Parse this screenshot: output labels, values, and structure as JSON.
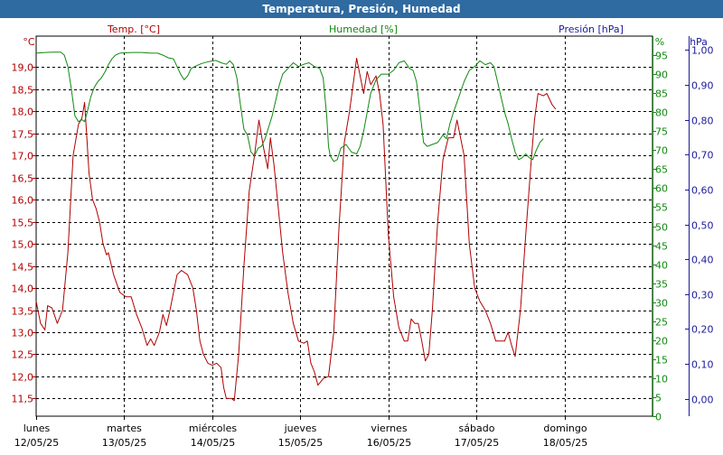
{
  "window": {
    "title": "Temperatura, Presión, Humedad"
  },
  "headers": {
    "temp": "Temp. [°C]",
    "hum": "Humedad [%]",
    "press": "Presión [hPa]"
  },
  "units": {
    "temp": "°C",
    "hum": "%",
    "press": "hPa"
  },
  "colors": {
    "temp": "#b00000",
    "hum": "#118811",
    "press": "#1a1a9a",
    "title_bg": "#2f6aa0"
  },
  "chart_data": {
    "type": "line",
    "title": "Temperatura, Presión, Humedad",
    "grid": true,
    "x_unit": "days",
    "x_range": [
      0,
      7
    ],
    "x_tick_days": [
      0,
      1,
      2,
      3,
      4,
      5,
      6
    ],
    "x_ticks": [
      {
        "day": "lunes",
        "date": "12/05/25"
      },
      {
        "day": "martes",
        "date": "13/05/25"
      },
      {
        "day": "miércoles",
        "date": "14/05/25"
      },
      {
        "day": "jueves",
        "date": "15/05/25"
      },
      {
        "day": "viernes",
        "date": "16/05/25"
      },
      {
        "day": "sábado",
        "date": "17/05/25"
      },
      {
        "day": "domingo",
        "date": "18/05/25"
      }
    ],
    "axes": {
      "temp": {
        "ylim": [
          11.1,
          19.7
        ],
        "ticks": [
          "11,5",
          "12,0",
          "12,5",
          "13,0",
          "13,5",
          "14,0",
          "14,5",
          "15,0",
          "15,5",
          "16,0",
          "16,5",
          "17,0",
          "17,5",
          "18,0",
          "18,5",
          "19,0"
        ],
        "tick_values": [
          11.5,
          12.0,
          12.5,
          13.0,
          13.5,
          14.0,
          14.5,
          15.0,
          15.5,
          16.0,
          16.5,
          17.0,
          17.5,
          18.0,
          18.5,
          19.0
        ]
      },
      "hum": {
        "ylim": [
          0,
          100
        ],
        "ticks": [
          "0",
          "5",
          "10",
          "15",
          "20",
          "25",
          "30",
          "35",
          "40",
          "45",
          "50",
          "55",
          "60",
          "65",
          "70",
          "75",
          "80",
          "85",
          "90",
          "95"
        ],
        "tick_values": [
          0,
          5,
          10,
          15,
          20,
          25,
          30,
          35,
          40,
          45,
          50,
          55,
          60,
          65,
          70,
          75,
          80,
          85,
          90,
          95
        ]
      },
      "press": {
        "ylim": [
          -0.05,
          1.04
        ],
        "ticks": [
          "0,00",
          "0,10",
          "0,20",
          "0,30",
          "0,40",
          "0,50",
          "0,60",
          "0,70",
          "0,80",
          "0,90",
          "1,00"
        ],
        "tick_values": [
          0.0,
          0.1,
          0.2,
          0.3,
          0.4,
          0.5,
          0.6,
          0.7,
          0.8,
          0.9,
          1.0
        ]
      }
    },
    "series": [
      {
        "name": "Temp. [°C]",
        "axis": "temp",
        "points": [
          [
            0.0,
            13.7
          ],
          [
            0.05,
            13.2
          ],
          [
            0.1,
            13.05
          ],
          [
            0.13,
            13.6
          ],
          [
            0.18,
            13.55
          ],
          [
            0.24,
            13.2
          ],
          [
            0.3,
            13.5
          ],
          [
            0.36,
            14.8
          ],
          [
            0.42,
            17.0
          ],
          [
            0.48,
            17.7
          ],
          [
            0.52,
            17.85
          ],
          [
            0.55,
            18.2
          ],
          [
            0.57,
            17.6
          ],
          [
            0.6,
            16.6
          ],
          [
            0.64,
            16.0
          ],
          [
            0.68,
            15.8
          ],
          [
            0.72,
            15.5
          ],
          [
            0.76,
            15.0
          ],
          [
            0.8,
            14.75
          ],
          [
            0.82,
            14.8
          ],
          [
            0.88,
            14.3
          ],
          [
            0.95,
            13.9
          ],
          [
            1.02,
            13.8
          ],
          [
            1.08,
            13.8
          ],
          [
            1.14,
            13.4
          ],
          [
            1.2,
            13.1
          ],
          [
            1.26,
            12.7
          ],
          [
            1.3,
            12.85
          ],
          [
            1.34,
            12.7
          ],
          [
            1.4,
            13.0
          ],
          [
            1.44,
            13.4
          ],
          [
            1.48,
            13.15
          ],
          [
            1.52,
            13.5
          ],
          [
            1.56,
            13.9
          ],
          [
            1.6,
            14.3
          ],
          [
            1.65,
            14.4
          ],
          [
            1.72,
            14.3
          ],
          [
            1.78,
            14.0
          ],
          [
            1.82,
            13.5
          ],
          [
            1.86,
            12.8
          ],
          [
            1.9,
            12.5
          ],
          [
            1.95,
            12.3
          ],
          [
            2.0,
            12.25
          ],
          [
            2.05,
            12.3
          ],
          [
            2.1,
            12.2
          ],
          [
            2.13,
            11.75
          ],
          [
            2.16,
            11.5
          ],
          [
            2.22,
            11.5
          ],
          [
            2.25,
            11.45
          ],
          [
            2.3,
            12.5
          ],
          [
            2.36,
            14.5
          ],
          [
            2.42,
            16.2
          ],
          [
            2.48,
            17.0
          ],
          [
            2.53,
            17.8
          ],
          [
            2.58,
            17.2
          ],
          [
            2.63,
            16.7
          ],
          [
            2.66,
            17.4
          ],
          [
            2.7,
            16.8
          ],
          [
            2.74,
            16.0
          ],
          [
            2.8,
            14.8
          ],
          [
            2.86,
            13.9
          ],
          [
            2.92,
            13.2
          ],
          [
            2.98,
            12.8
          ],
          [
            3.04,
            12.75
          ],
          [
            3.08,
            12.8
          ],
          [
            3.12,
            12.3
          ],
          [
            3.16,
            12.1
          ],
          [
            3.2,
            11.8
          ],
          [
            3.26,
            11.95
          ],
          [
            3.32,
            12.0
          ],
          [
            3.38,
            13.0
          ],
          [
            3.44,
            15.4
          ],
          [
            3.5,
            17.3
          ],
          [
            3.56,
            18.0
          ],
          [
            3.6,
            18.6
          ],
          [
            3.64,
            19.2
          ],
          [
            3.68,
            18.8
          ],
          [
            3.72,
            18.4
          ],
          [
            3.76,
            18.9
          ],
          [
            3.8,
            18.6
          ],
          [
            3.86,
            18.8
          ],
          [
            3.9,
            18.4
          ],
          [
            3.94,
            17.7
          ],
          [
            4.0,
            15.2
          ],
          [
            4.06,
            13.8
          ],
          [
            4.12,
            13.1
          ],
          [
            4.18,
            12.8
          ],
          [
            4.22,
            12.8
          ],
          [
            4.26,
            13.3
          ],
          [
            4.3,
            13.2
          ],
          [
            4.34,
            13.2
          ],
          [
            4.38,
            12.8
          ],
          [
            4.42,
            12.35
          ],
          [
            4.46,
            12.5
          ],
          [
            4.5,
            13.5
          ],
          [
            4.56,
            15.5
          ],
          [
            4.62,
            16.9
          ],
          [
            4.68,
            17.4
          ],
          [
            4.74,
            17.4
          ],
          [
            4.78,
            17.8
          ],
          [
            4.82,
            17.4
          ],
          [
            4.86,
            17.0
          ],
          [
            4.92,
            15.0
          ],
          [
            4.98,
            14.0
          ],
          [
            5.04,
            13.7
          ],
          [
            5.1,
            13.5
          ],
          [
            5.16,
            13.2
          ],
          [
            5.22,
            12.8
          ],
          [
            5.28,
            12.8
          ],
          [
            5.32,
            12.8
          ],
          [
            5.36,
            13.0
          ],
          [
            5.4,
            12.7
          ],
          [
            5.44,
            12.45
          ],
          [
            5.5,
            13.5
          ],
          [
            5.56,
            15.2
          ],
          [
            5.62,
            16.8
          ],
          [
            5.66,
            17.8
          ],
          [
            5.7,
            18.4
          ],
          [
            5.76,
            18.35
          ],
          [
            5.8,
            18.4
          ],
          [
            5.86,
            18.15
          ],
          [
            5.9,
            18.05
          ]
        ]
      },
      {
        "name": "Humedad [%]",
        "axis": "hum",
        "points": [
          [
            0.0,
            95.5
          ],
          [
            0.1,
            95.7
          ],
          [
            0.2,
            95.8
          ],
          [
            0.28,
            95.8
          ],
          [
            0.32,
            95.0
          ],
          [
            0.36,
            92.0
          ],
          [
            0.4,
            86.0
          ],
          [
            0.44,
            79.0
          ],
          [
            0.48,
            77.5
          ],
          [
            0.52,
            78.0
          ],
          [
            0.55,
            77.5
          ],
          [
            0.58,
            80.0
          ],
          [
            0.62,
            84.0
          ],
          [
            0.66,
            86.5
          ],
          [
            0.7,
            88.0
          ],
          [
            0.74,
            89.0
          ],
          [
            0.78,
            90.5
          ],
          [
            0.82,
            92.5
          ],
          [
            0.86,
            94.0
          ],
          [
            0.9,
            95.0
          ],
          [
            0.95,
            95.5
          ],
          [
            1.0,
            95.6
          ],
          [
            1.1,
            95.7
          ],
          [
            1.2,
            95.7
          ],
          [
            1.3,
            95.5
          ],
          [
            1.38,
            95.5
          ],
          [
            1.44,
            95.0
          ],
          [
            1.5,
            94.3
          ],
          [
            1.56,
            94.0
          ],
          [
            1.6,
            92.0
          ],
          [
            1.64,
            90.0
          ],
          [
            1.68,
            88.5
          ],
          [
            1.72,
            89.5
          ],
          [
            1.76,
            91.5
          ],
          [
            1.82,
            92.2
          ],
          [
            1.88,
            92.8
          ],
          [
            1.96,
            93.3
          ],
          [
            2.04,
            93.6
          ],
          [
            2.1,
            93.0
          ],
          [
            2.16,
            92.6
          ],
          [
            2.2,
            93.5
          ],
          [
            2.24,
            92.5
          ],
          [
            2.28,
            89.0
          ],
          [
            2.32,
            82.0
          ],
          [
            2.36,
            75.5
          ],
          [
            2.4,
            74.0
          ],
          [
            2.44,
            69.5
          ],
          [
            2.48,
            68.5
          ],
          [
            2.52,
            70.5
          ],
          [
            2.56,
            71.0
          ],
          [
            2.6,
            73.0
          ],
          [
            2.64,
            76.0
          ],
          [
            2.68,
            79.0
          ],
          [
            2.72,
            83.0
          ],
          [
            2.76,
            87.0
          ],
          [
            2.8,
            90.0
          ],
          [
            2.86,
            91.5
          ],
          [
            2.92,
            93.0
          ],
          [
            2.98,
            92.0
          ],
          [
            3.04,
            92.6
          ],
          [
            3.1,
            93.0
          ],
          [
            3.16,
            92.0
          ],
          [
            3.22,
            91.5
          ],
          [
            3.26,
            89.0
          ],
          [
            3.3,
            79.0
          ],
          [
            3.32,
            71.0
          ],
          [
            3.34,
            68.5
          ],
          [
            3.38,
            67.0
          ],
          [
            3.42,
            67.5
          ],
          [
            3.46,
            70.5
          ],
          [
            3.52,
            71.5
          ],
          [
            3.58,
            69.5
          ],
          [
            3.64,
            69.0
          ],
          [
            3.68,
            71.0
          ],
          [
            3.72,
            75.0
          ],
          [
            3.76,
            80.0
          ],
          [
            3.8,
            85.0
          ],
          [
            3.86,
            88.5
          ],
          [
            3.92,
            90.0
          ],
          [
            4.0,
            90.0
          ],
          [
            4.06,
            91.0
          ],
          [
            4.12,
            93.0
          ],
          [
            4.18,
            93.5
          ],
          [
            4.24,
            91.5
          ],
          [
            4.28,
            91.0
          ],
          [
            4.32,
            88.0
          ],
          [
            4.36,
            80.0
          ],
          [
            4.4,
            72.0
          ],
          [
            4.44,
            71.0
          ],
          [
            4.5,
            71.5
          ],
          [
            4.56,
            72.0
          ],
          [
            4.62,
            74.0
          ],
          [
            4.66,
            73.0
          ],
          [
            4.7,
            77.0
          ],
          [
            4.74,
            80.0
          ],
          [
            4.8,
            84.0
          ],
          [
            4.86,
            88.0
          ],
          [
            4.92,
            91.0
          ],
          [
            4.98,
            92.0
          ],
          [
            5.04,
            93.5
          ],
          [
            5.1,
            92.5
          ],
          [
            5.16,
            93.0
          ],
          [
            5.2,
            92.0
          ],
          [
            5.24,
            88.0
          ],
          [
            5.28,
            84.0
          ],
          [
            5.32,
            80.0
          ],
          [
            5.36,
            77.0
          ],
          [
            5.4,
            73.0
          ],
          [
            5.44,
            69.5
          ],
          [
            5.48,
            67.5
          ],
          [
            5.52,
            68.0
          ],
          [
            5.56,
            69.0
          ],
          [
            5.6,
            68.0
          ],
          [
            5.64,
            67.5
          ],
          [
            5.68,
            70.0
          ],
          [
            5.72,
            72.0
          ],
          [
            5.76,
            73.0
          ]
        ]
      }
    ]
  }
}
